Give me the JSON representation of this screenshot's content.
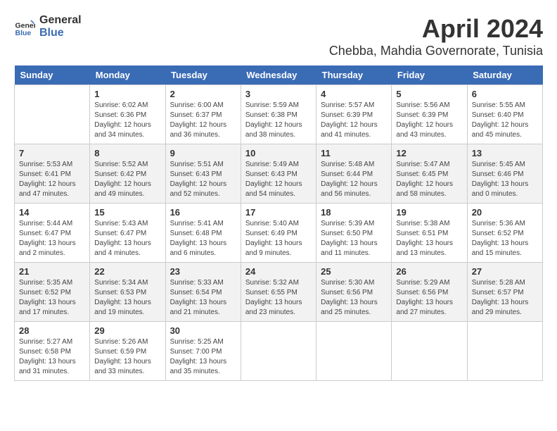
{
  "header": {
    "logo_line1": "General",
    "logo_line2": "Blue",
    "month": "April 2024",
    "location": "Chebba, Mahdia Governorate, Tunisia"
  },
  "days_of_week": [
    "Sunday",
    "Monday",
    "Tuesday",
    "Wednesday",
    "Thursday",
    "Friday",
    "Saturday"
  ],
  "weeks": [
    [
      {
        "day": "",
        "content": ""
      },
      {
        "day": "1",
        "content": "Sunrise: 6:02 AM\nSunset: 6:36 PM\nDaylight: 12 hours\nand 34 minutes."
      },
      {
        "day": "2",
        "content": "Sunrise: 6:00 AM\nSunset: 6:37 PM\nDaylight: 12 hours\nand 36 minutes."
      },
      {
        "day": "3",
        "content": "Sunrise: 5:59 AM\nSunset: 6:38 PM\nDaylight: 12 hours\nand 38 minutes."
      },
      {
        "day": "4",
        "content": "Sunrise: 5:57 AM\nSunset: 6:39 PM\nDaylight: 12 hours\nand 41 minutes."
      },
      {
        "day": "5",
        "content": "Sunrise: 5:56 AM\nSunset: 6:39 PM\nDaylight: 12 hours\nand 43 minutes."
      },
      {
        "day": "6",
        "content": "Sunrise: 5:55 AM\nSunset: 6:40 PM\nDaylight: 12 hours\nand 45 minutes."
      }
    ],
    [
      {
        "day": "7",
        "content": "Sunrise: 5:53 AM\nSunset: 6:41 PM\nDaylight: 12 hours\nand 47 minutes."
      },
      {
        "day": "8",
        "content": "Sunrise: 5:52 AM\nSunset: 6:42 PM\nDaylight: 12 hours\nand 49 minutes."
      },
      {
        "day": "9",
        "content": "Sunrise: 5:51 AM\nSunset: 6:43 PM\nDaylight: 12 hours\nand 52 minutes."
      },
      {
        "day": "10",
        "content": "Sunrise: 5:49 AM\nSunset: 6:43 PM\nDaylight: 12 hours\nand 54 minutes."
      },
      {
        "day": "11",
        "content": "Sunrise: 5:48 AM\nSunset: 6:44 PM\nDaylight: 12 hours\nand 56 minutes."
      },
      {
        "day": "12",
        "content": "Sunrise: 5:47 AM\nSunset: 6:45 PM\nDaylight: 12 hours\nand 58 minutes."
      },
      {
        "day": "13",
        "content": "Sunrise: 5:45 AM\nSunset: 6:46 PM\nDaylight: 13 hours\nand 0 minutes."
      }
    ],
    [
      {
        "day": "14",
        "content": "Sunrise: 5:44 AM\nSunset: 6:47 PM\nDaylight: 13 hours\nand 2 minutes."
      },
      {
        "day": "15",
        "content": "Sunrise: 5:43 AM\nSunset: 6:47 PM\nDaylight: 13 hours\nand 4 minutes."
      },
      {
        "day": "16",
        "content": "Sunrise: 5:41 AM\nSunset: 6:48 PM\nDaylight: 13 hours\nand 6 minutes."
      },
      {
        "day": "17",
        "content": "Sunrise: 5:40 AM\nSunset: 6:49 PM\nDaylight: 13 hours\nand 9 minutes."
      },
      {
        "day": "18",
        "content": "Sunrise: 5:39 AM\nSunset: 6:50 PM\nDaylight: 13 hours\nand 11 minutes."
      },
      {
        "day": "19",
        "content": "Sunrise: 5:38 AM\nSunset: 6:51 PM\nDaylight: 13 hours\nand 13 minutes."
      },
      {
        "day": "20",
        "content": "Sunrise: 5:36 AM\nSunset: 6:52 PM\nDaylight: 13 hours\nand 15 minutes."
      }
    ],
    [
      {
        "day": "21",
        "content": "Sunrise: 5:35 AM\nSunset: 6:52 PM\nDaylight: 13 hours\nand 17 minutes."
      },
      {
        "day": "22",
        "content": "Sunrise: 5:34 AM\nSunset: 6:53 PM\nDaylight: 13 hours\nand 19 minutes."
      },
      {
        "day": "23",
        "content": "Sunrise: 5:33 AM\nSunset: 6:54 PM\nDaylight: 13 hours\nand 21 minutes."
      },
      {
        "day": "24",
        "content": "Sunrise: 5:32 AM\nSunset: 6:55 PM\nDaylight: 13 hours\nand 23 minutes."
      },
      {
        "day": "25",
        "content": "Sunrise: 5:30 AM\nSunset: 6:56 PM\nDaylight: 13 hours\nand 25 minutes."
      },
      {
        "day": "26",
        "content": "Sunrise: 5:29 AM\nSunset: 6:56 PM\nDaylight: 13 hours\nand 27 minutes."
      },
      {
        "day": "27",
        "content": "Sunrise: 5:28 AM\nSunset: 6:57 PM\nDaylight: 13 hours\nand 29 minutes."
      }
    ],
    [
      {
        "day": "28",
        "content": "Sunrise: 5:27 AM\nSunset: 6:58 PM\nDaylight: 13 hours\nand 31 minutes."
      },
      {
        "day": "29",
        "content": "Sunrise: 5:26 AM\nSunset: 6:59 PM\nDaylight: 13 hours\nand 33 minutes."
      },
      {
        "day": "30",
        "content": "Sunrise: 5:25 AM\nSunset: 7:00 PM\nDaylight: 13 hours\nand 35 minutes."
      },
      {
        "day": "",
        "content": ""
      },
      {
        "day": "",
        "content": ""
      },
      {
        "day": "",
        "content": ""
      },
      {
        "day": "",
        "content": ""
      }
    ]
  ]
}
